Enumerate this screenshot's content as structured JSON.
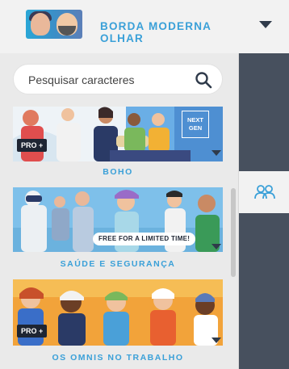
{
  "header": {
    "title": "BORDA MODERNA OLHAR",
    "dropdown_icon": "chevron-down-icon",
    "thumbnail_icon": "character-pack-thumbnail"
  },
  "search": {
    "placeholder": "Pesquisar caracteres",
    "icon": "search-icon"
  },
  "packs": [
    {
      "label": "BOHO",
      "badge": "PRO +",
      "corner_badge": "NEXT GEN"
    },
    {
      "label": "SAÚDE E SEGURANÇA",
      "promo": "FREE FOR A LIMITED TIME!"
    },
    {
      "label": "OS OMNIS NO TRABALHO",
      "badge": "PRO +"
    }
  ],
  "rail": {
    "active_tab_icon": "people-icon"
  },
  "colors": {
    "accent": "#3aa0d8",
    "rail": "#47505e",
    "dark": "#1e2533"
  }
}
